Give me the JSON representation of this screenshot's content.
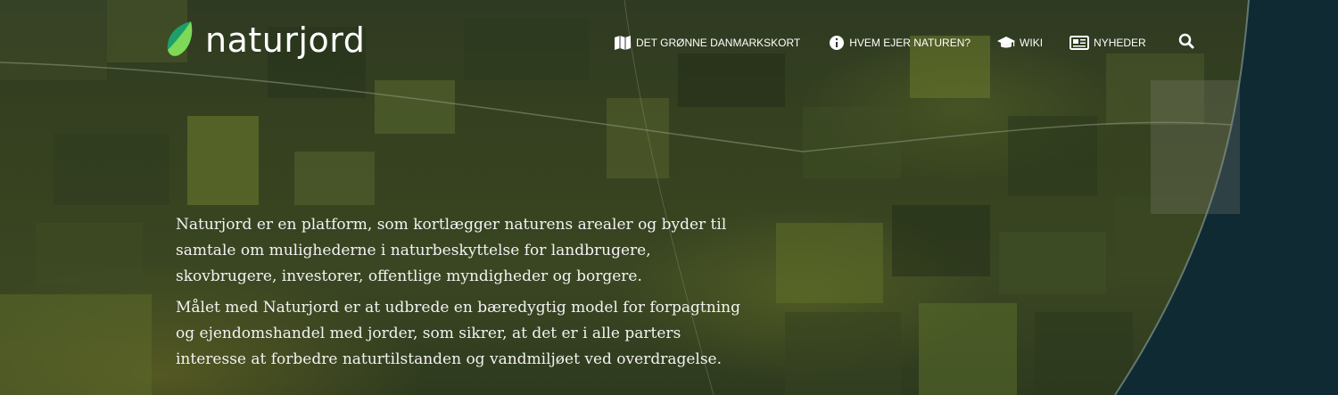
{
  "header": {
    "logo_text": "naturjord",
    "logo_icon": "leaf-icon",
    "nav": [
      {
        "label": "DET GRØNNE DANMARKSKORT",
        "icon": "map-icon"
      },
      {
        "label": "HVEM EJER NATUREN?",
        "icon": "info-icon"
      },
      {
        "label": "WIKI",
        "icon": "graduation-cap-icon"
      },
      {
        "label": "NYHEDER",
        "icon": "newspaper-icon"
      }
    ],
    "search_icon": "search-icon"
  },
  "intro": {
    "paragraph_1": "Naturjord er en platform, som kortlægger naturens arealer og byder til samtale om mulighederne i naturbeskyttelse for landbrugere, skovbrugere, investorer, offentlige myndigheder og borgere.",
    "paragraph_2": "Målet med Naturjord er at udbrede en bæredygtig model for forpagtning og ejendomshandel med jorder, som sikrer, at det er i alle parters interesse at forbedre naturtilstanden og vandmiljøet ved overdragelse."
  },
  "colors": {
    "text": "#ffffff",
    "leaf_light": "#7ed957",
    "leaf_dark": "#1e9e6a",
    "sea": "#0f2a33"
  }
}
